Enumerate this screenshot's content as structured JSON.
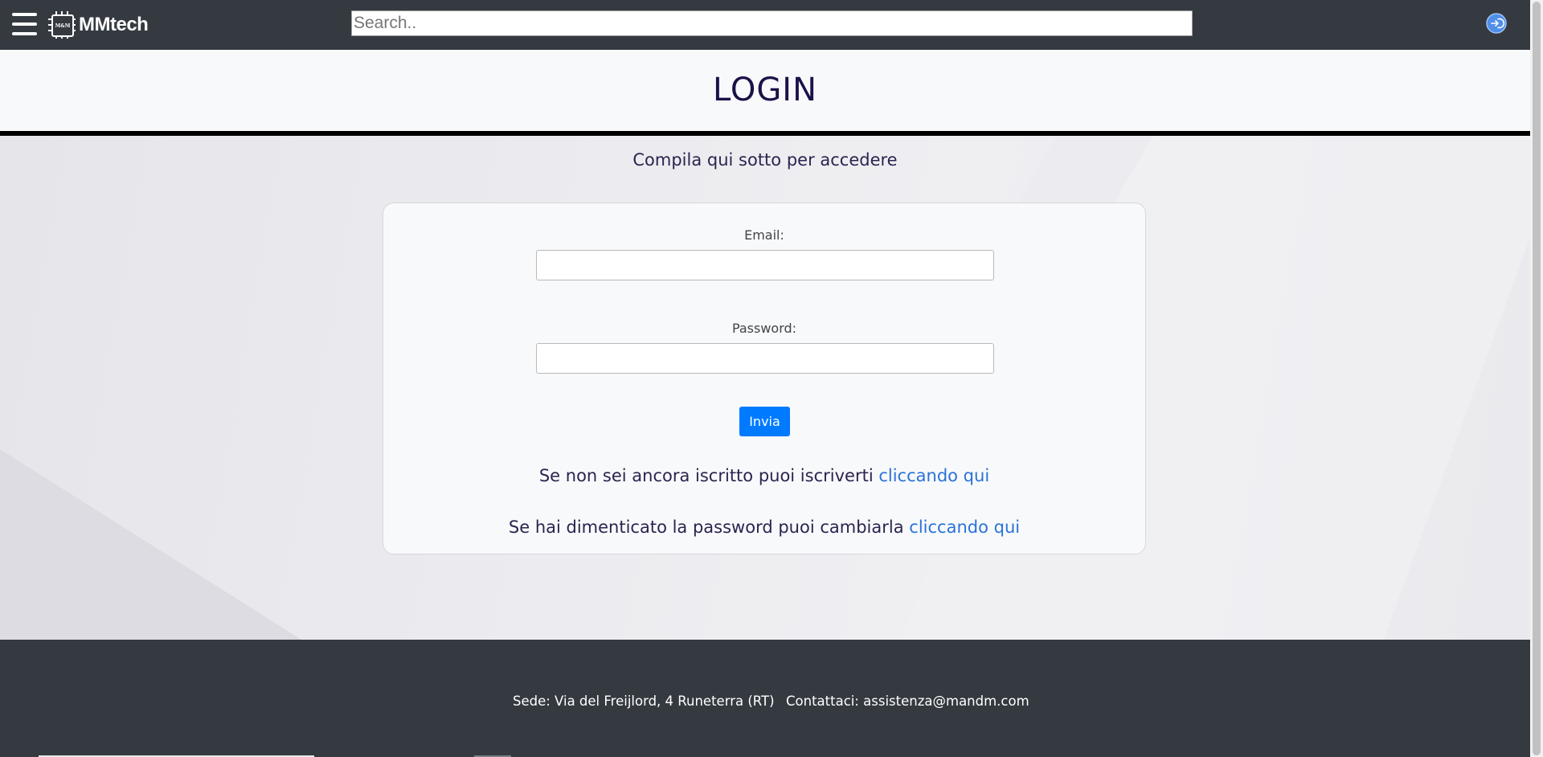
{
  "app": {
    "brand_name": "MMtech",
    "logo_text": "M&M"
  },
  "navbar": {
    "search_placeholder": "Search..",
    "menu_icon": "hamburger-menu-icon",
    "login_icon": "login-icon"
  },
  "page": {
    "title": "LOGIN",
    "subtitle": "Compila qui sotto per accedere"
  },
  "form": {
    "email_label": "Email:",
    "email_value": "",
    "password_label": "Password:",
    "password_value": "",
    "submit_label": "Invia"
  },
  "links": {
    "register_text": "Se non sei ancora iscritto puoi iscriverti",
    "register_link": "cliccando qui",
    "reset_text": "Se hai dimenticato la password puoi cambiarla",
    "reset_link": "cliccando qui"
  },
  "footer": {
    "address": "Sede: Via del Freijlord, 4 Runeterra (RT)",
    "contact": "Contattaci: assistenza@mandm.com"
  },
  "colors": {
    "navbar_bg": "#343a40",
    "primary_button": "#007bff",
    "link": "#2a73d8",
    "title": "#1c1148"
  }
}
